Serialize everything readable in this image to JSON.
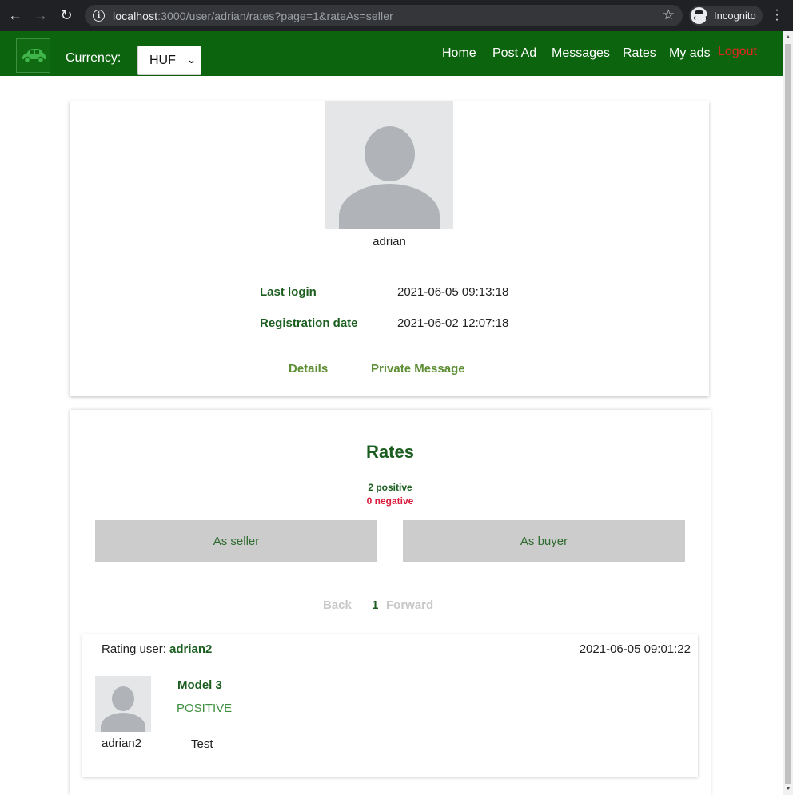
{
  "browser": {
    "url_host": "localhost",
    "url_rest": ":3000/user/adrian/rates?page=1&rateAs=seller",
    "profile_label": "Incognito"
  },
  "header": {
    "currency_label": "Currency:",
    "currency_value": "HUF",
    "nav": {
      "home": "Home",
      "post_ad": "Post Ad",
      "messages": "Messages",
      "rates": "Rates",
      "my_ads": "My ads",
      "logout": "Logout"
    },
    "colors": {
      "bar": "#0c640f",
      "logout": "#e4261f"
    }
  },
  "profile": {
    "username": "adrian",
    "last_login_label": "Last login",
    "last_login_value": "2021-06-05 09:13:18",
    "registration_label": "Registration date",
    "registration_value": "2021-06-02 12:07:18",
    "details_link": "Details",
    "private_message_link": "Private Message"
  },
  "rates": {
    "title": "Rates",
    "positive_text": "2 positive",
    "negative_text": "0 negative",
    "tab_seller": "As seller",
    "tab_buyer": "As buyer",
    "pager": {
      "back": "Back",
      "current": "1",
      "forward": "Forward"
    },
    "items": [
      {
        "rating_user_label": "Rating user:",
        "rating_user": "adrian2",
        "date": "2021-06-05 09:01:22",
        "rater_name": "adrian2",
        "ad_title": "Model 3",
        "type": "POSITIVE",
        "comment": "Test"
      }
    ]
  }
}
